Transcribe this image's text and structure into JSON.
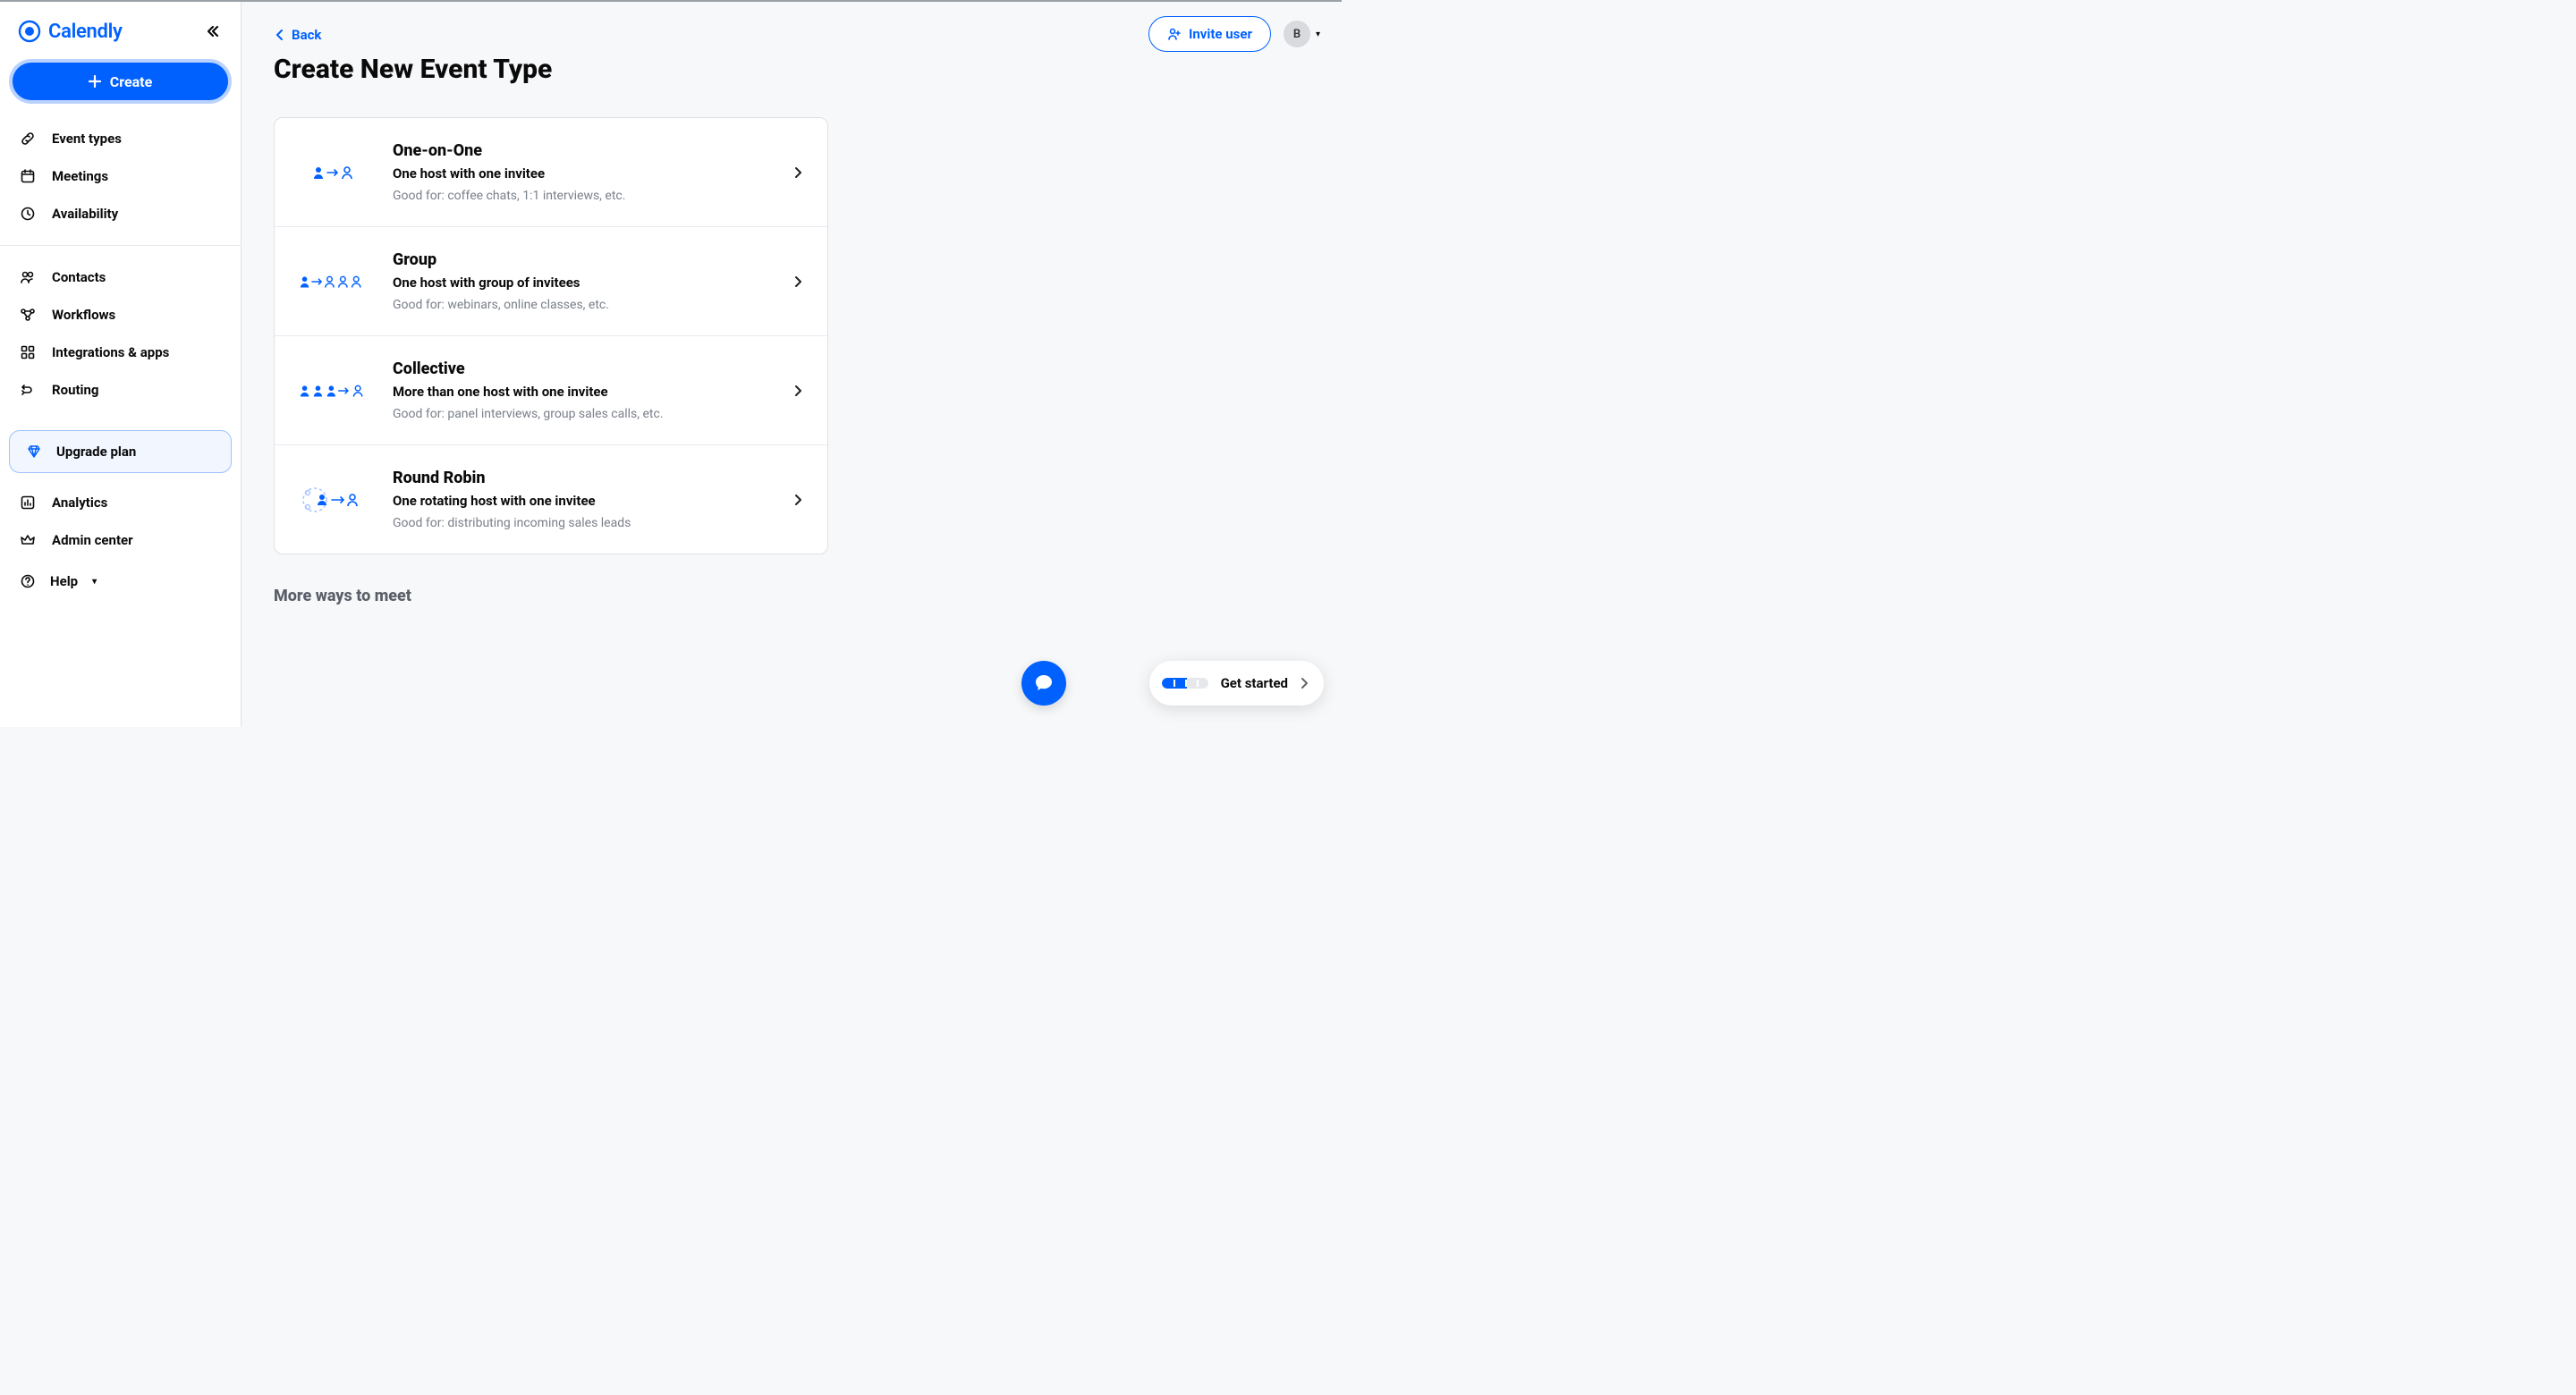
{
  "brand": {
    "name": "Calendly"
  },
  "sidebar": {
    "create_label": "Create",
    "items_a": [
      {
        "label": "Event types"
      },
      {
        "label": "Meetings"
      },
      {
        "label": "Availability"
      }
    ],
    "items_b": [
      {
        "label": "Contacts"
      },
      {
        "label": "Workflows"
      },
      {
        "label": "Integrations & apps"
      },
      {
        "label": "Routing"
      }
    ],
    "upgrade_label": "Upgrade plan",
    "items_c": [
      {
        "label": "Analytics"
      },
      {
        "label": "Admin center"
      }
    ],
    "help_label": "Help"
  },
  "topbar": {
    "invite_label": "Invite user",
    "avatar_initial": "B"
  },
  "page": {
    "back_label": "Back",
    "title": "Create New Event Type",
    "more_ways": "More ways to meet"
  },
  "event_types": [
    {
      "title": "One-on-One",
      "subtitle": "One host with one invitee",
      "desc": "Good for: coffee chats, 1:1 interviews, etc."
    },
    {
      "title": "Group",
      "subtitle": "One host with group of invitees",
      "desc": "Good for: webinars, online classes, etc."
    },
    {
      "title": "Collective",
      "subtitle": "More than one host with one invitee",
      "desc": "Good for: panel interviews, group sales calls, etc."
    },
    {
      "title": "Round Robin",
      "subtitle": "One rotating host with one invitee",
      "desc": "Good for: distributing incoming sales leads"
    }
  ],
  "get_started": {
    "label": "Get started"
  }
}
